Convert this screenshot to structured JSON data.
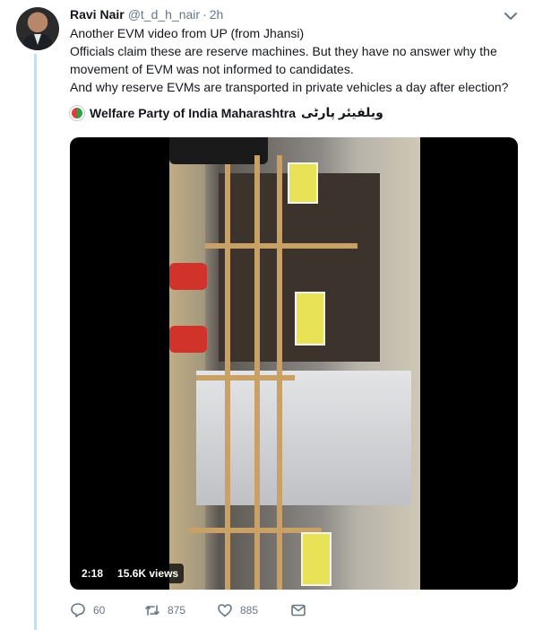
{
  "tweet": {
    "author_name": "Ravi Nair",
    "author_handle": "@t_d_h_nair",
    "separator": "·",
    "time": "2h",
    "lines": [
      "Another EVM video from UP (from Jhansi)",
      "Officials claim these are reserve machines. But they have no answer why the",
      "movement of EVM was not informed to candidates.",
      "And why reserve EVMs are transported in private vehicles a day after election?"
    ],
    "quoted_source": "Welfare Party of India Maharashtra",
    "quoted_source_urdu": "ویلفیئر پارٹی"
  },
  "media": {
    "duration": "2:18",
    "views": "15.6K views"
  },
  "actions": {
    "reply_count": "60",
    "retweet_count": "875",
    "like_count": "885"
  },
  "icons": {
    "menu": "chevron-down-icon",
    "reply": "reply-icon",
    "retweet": "retweet-icon",
    "like": "heart-icon",
    "dm": "envelope-icon"
  },
  "colors": {
    "thread_line": "#c4dfef",
    "secondary_text": "#657786",
    "primary_text": "#14171a"
  }
}
